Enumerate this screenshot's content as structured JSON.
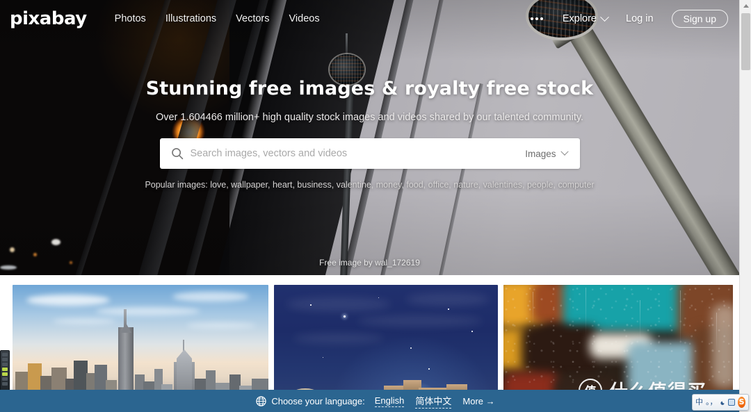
{
  "brand": {
    "logo_text": "pixabay"
  },
  "nav": {
    "links": [
      {
        "label": "Photos"
      },
      {
        "label": "Illustrations"
      },
      {
        "label": "Vectors"
      },
      {
        "label": "Videos"
      }
    ],
    "more_icon": "ellipsis-icon",
    "explore_label": "Explore",
    "explore_chevron": "chevron-down-icon",
    "login_label": "Log in",
    "signup_label": "Sign up"
  },
  "hero": {
    "title": "Stunning free images & royalty free stock",
    "subtitle": "Over 1.604466 million+ high quality stock images and videos shared by our talented community.",
    "credit": "Free image by wal_172619"
  },
  "search": {
    "icon": "search-icon",
    "value": "",
    "placeholder": "Search images, vectors and videos",
    "type_label": "Images",
    "type_chevron": "chevron-down-icon"
  },
  "popular": {
    "prefix": "Popular images:",
    "tags": [
      "love",
      "wallpaper",
      "heart",
      "business",
      "valentine",
      "money",
      "food",
      "office",
      "nature",
      "valentines",
      "people",
      "computer"
    ]
  },
  "gallery": {
    "tiles": [
      {
        "name": "tile-city-skyline",
        "alt": "New York City skyline at dusk"
      },
      {
        "name": "tile-starry-night",
        "alt": "Starry night sky over desert ruins"
      },
      {
        "name": "tile-rain-window",
        "alt": "Rain drops on window with teal and orange bokeh"
      }
    ]
  },
  "language_bar": {
    "globe_icon": "globe-icon",
    "label": "Choose your language:",
    "options": [
      {
        "label": "English"
      },
      {
        "label": "简体中文"
      }
    ],
    "more_label": "More →"
  },
  "watermark": {
    "badge_text": "值",
    "text": "什么值得买"
  },
  "ime": {
    "mode_label": "中",
    "punct_label": "。，",
    "moon_icon": "moon-icon",
    "keyboard_icon": "keyboard-icon",
    "sogou_label": "S"
  },
  "scrollbar": {
    "up_icon": "scroll-up-arrow-icon"
  },
  "colors": {
    "language_bar_bg": "#2b6590",
    "hero_dark": "#080809",
    "hero_sky": "#b0aeb4",
    "accent_white": "#ffffff"
  }
}
